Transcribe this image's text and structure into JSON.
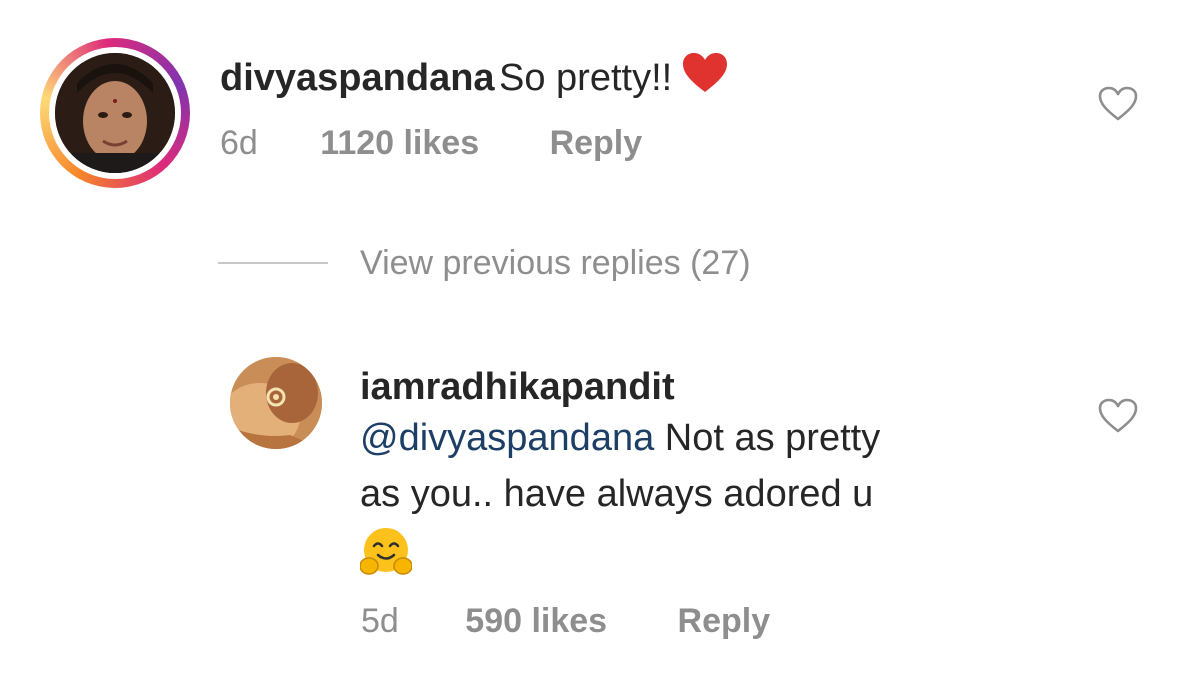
{
  "comments": [
    {
      "username": "divyaspandana",
      "text": "So pretty!!",
      "time": "6d",
      "likes": "1120 likes",
      "reply_label": "Reply"
    },
    {
      "username": "iamradhikapandit",
      "mention": "@divyaspandana",
      "text_line1_rest": " Not as pretty",
      "text_line2": "as you.. have always adored u",
      "time": "5d",
      "likes": "590 likes",
      "reply_label": "Reply"
    }
  ],
  "view_previous": "View previous replies (27)",
  "colors": {
    "heart_emoji": "#e0322f",
    "mention": "#1d3f66",
    "meta_gray": "#8e8e8e"
  },
  "icons": [
    "heart-emoji",
    "like-heart-icon",
    "hugging-face-emoji"
  ]
}
